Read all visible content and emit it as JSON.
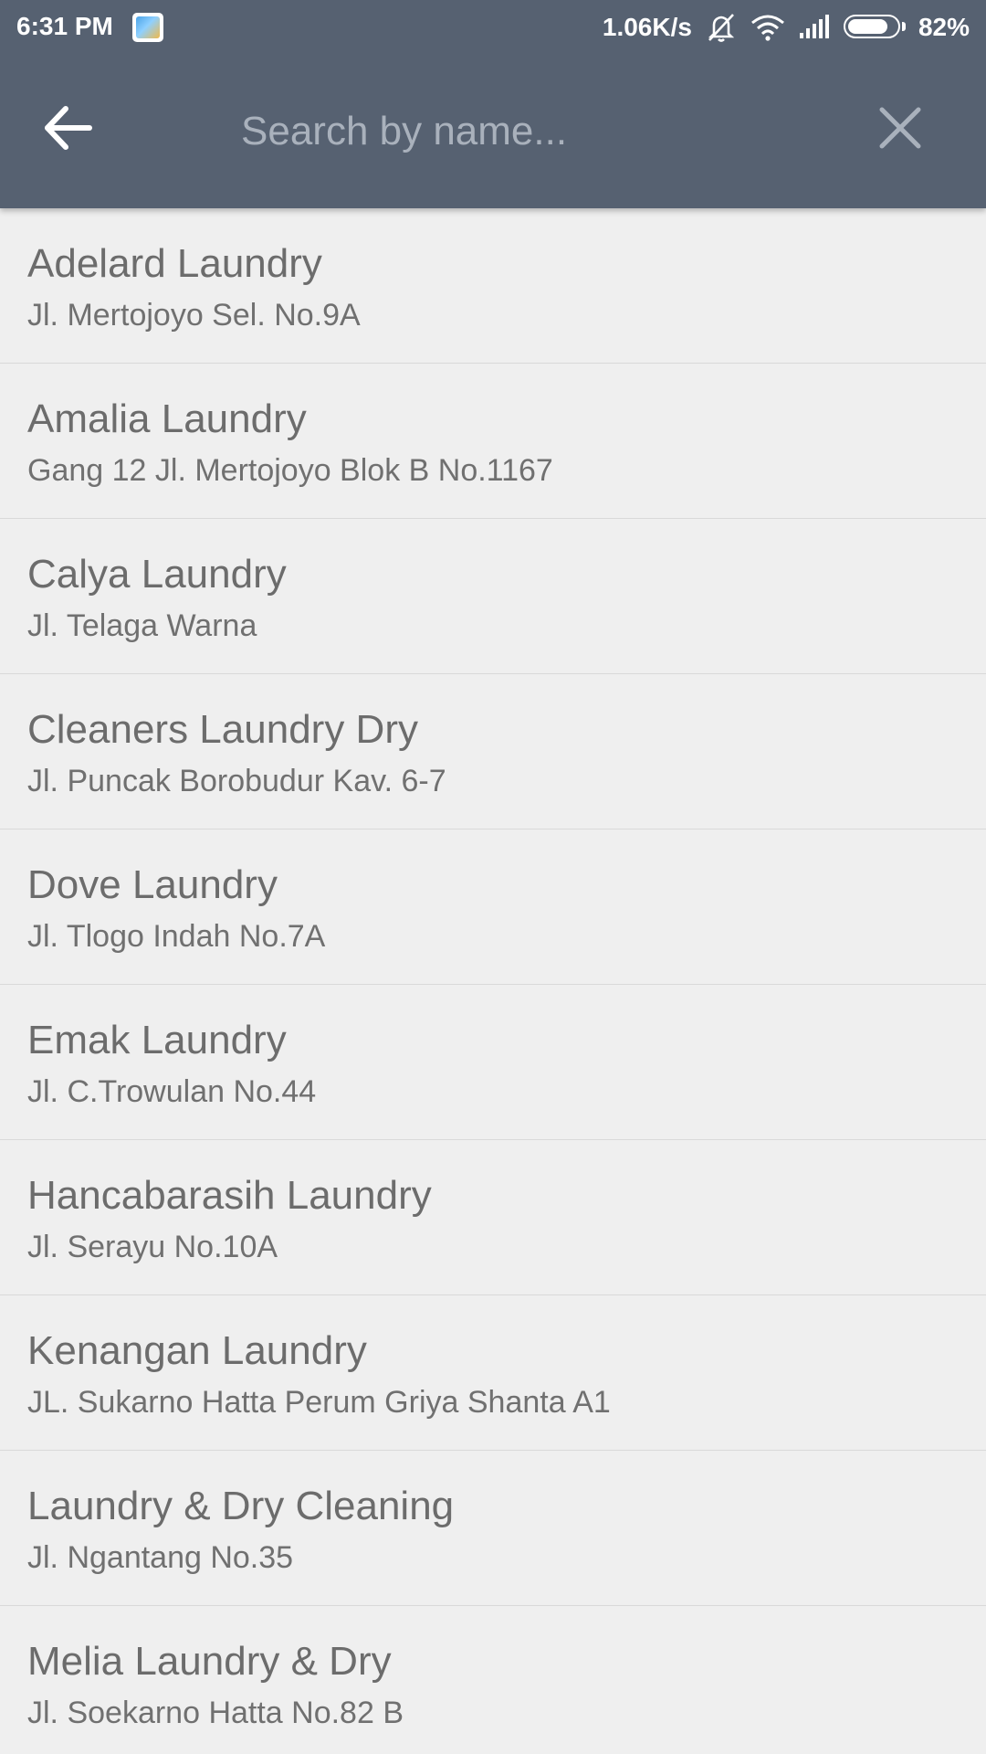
{
  "status_bar": {
    "time": "6:31 PM",
    "network_speed": "1.06K/s",
    "battery_percent": "82%",
    "battery_level": 0.82,
    "icons": [
      "app-icon",
      "mute-vibrate-icon",
      "wifi-icon",
      "signal-icon",
      "battery-icon"
    ]
  },
  "search_bar": {
    "placeholder": "Search by name...",
    "value": "",
    "back_icon": "arrow-left-icon",
    "clear_icon": "close-icon"
  },
  "colors": {
    "toolbar": "#566171",
    "background": "#efefef",
    "text": "#6c6c6c",
    "divider": "#d9d9d9"
  },
  "laundries": [
    {
      "name": "Adelard Laundry",
      "address": "Jl. Mertojoyo Sel. No.9A"
    },
    {
      "name": "Amalia Laundry",
      "address": "Gang 12 Jl. Mertojoyo Blok B No.1167"
    },
    {
      "name": "Calya Laundry",
      "address": "Jl. Telaga Warna"
    },
    {
      "name": "Cleaners Laundry Dry",
      "address": "Jl. Puncak Borobudur Kav. 6-7"
    },
    {
      "name": "Dove Laundry",
      "address": "Jl. Tlogo Indah No.7A"
    },
    {
      "name": "Emak Laundry",
      "address": "Jl. C.Trowulan No.44"
    },
    {
      "name": "Hancabarasih Laundry",
      "address": "Jl. Serayu No.10A"
    },
    {
      "name": "Kenangan Laundry",
      "address": "JL. Sukarno Hatta Perum Griya Shanta A1"
    },
    {
      "name": "Laundry & Dry Cleaning",
      "address": "Jl. Ngantang No.35"
    },
    {
      "name": "Melia Laundry & Dry",
      "address": "Jl. Soekarno Hatta No.82 B"
    }
  ]
}
